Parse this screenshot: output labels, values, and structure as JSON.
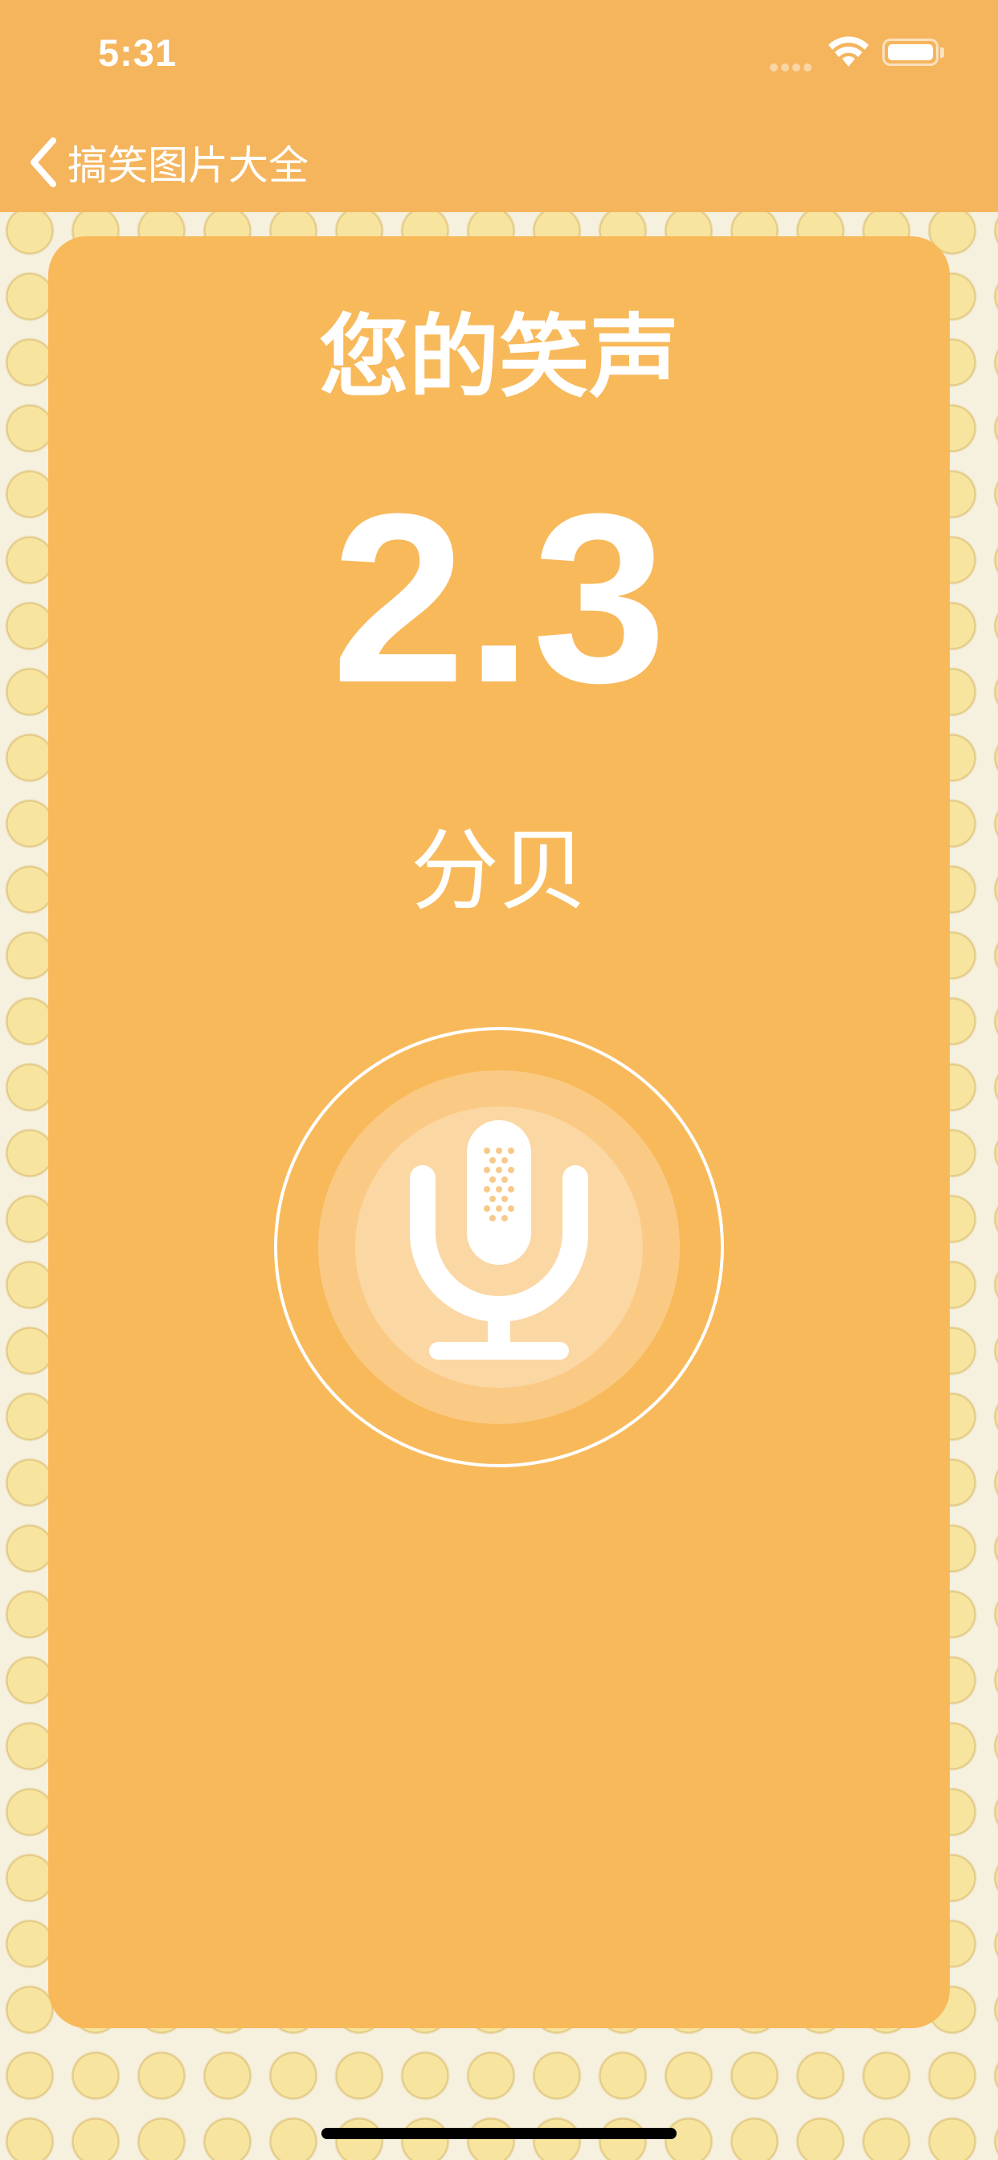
{
  "status_bar": {
    "time": "5:31"
  },
  "nav": {
    "back_label": "搞笑图片大全"
  },
  "card": {
    "title": "您的笑声",
    "score": "2.3",
    "unit": "分贝"
  },
  "colors": {
    "accent": "#f5b55d",
    "card": "#f8b95b",
    "background": "#f6f1df",
    "text": "#ffffff"
  },
  "icons": {
    "back": "chevron-left-icon",
    "mic": "microphone-icon",
    "wifi": "wifi-icon",
    "battery": "battery-icon",
    "signal": "cellular-signal-icon"
  }
}
